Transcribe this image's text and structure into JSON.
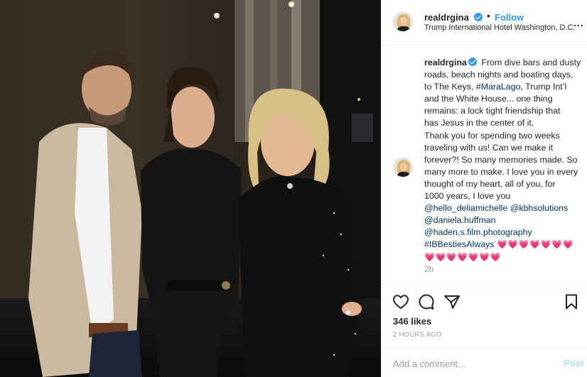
{
  "post": {
    "username": "realdrgina",
    "follow_label": "Follow",
    "separator": "•",
    "location": "Trump International Hotel Washington, D.C.",
    "more_label": "...",
    "caption": {
      "username": "realdrgina",
      "lines": [
        "From dive bars and dusty",
        "roads, beach nights and boating days,",
        "to The Keys,",
        "#MaraLago",
        ", Trump Int’l",
        "and the White House... one thing",
        "remains: a lock tight friendship that",
        "has Jesus in the center of it.",
        "Thank you for spending two weeks",
        "traveling with us! Can we make it",
        "forever?! So many memories made. So",
        "many more to make. I love you in every",
        "thought of my heart, all of you, for",
        "1000 years, I love you"
      ],
      "mentions": [
        "@hello_deliamichelle",
        "@kbhsolutions",
        "@daniela.huffman",
        "@haden.s.film.photography",
        "#IBBestiesAlways"
      ],
      "hearts_line1": "💗💗💗💗💗💗💗",
      "hearts_line2": "💗💗💗💗💗💗💗"
    },
    "time_short": "2h",
    "likes": "346 likes",
    "time_ago": "2 HOURS AGO",
    "comment_placeholder": "Add a comment…",
    "post_label": "Post"
  },
  "icons": [
    "heart-icon",
    "comment-icon",
    "share-icon",
    "bookmark-icon",
    "verified-badge-icon"
  ],
  "colors": {
    "link": "#003569",
    "accent": "#3897f0",
    "muted": "#999999",
    "post_disabled": "#b2dffc",
    "hearts": "#e64fb0"
  }
}
